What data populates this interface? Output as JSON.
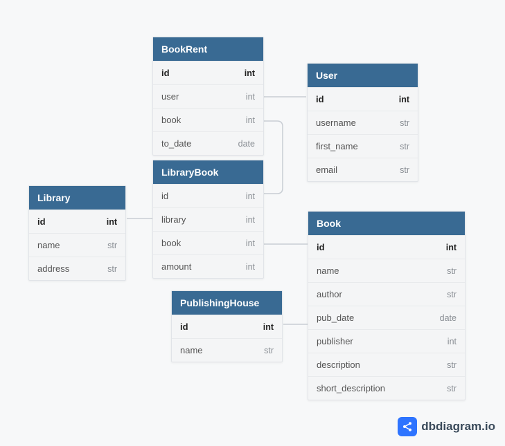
{
  "tables": {
    "bookrent": {
      "title": "BookRent",
      "rows": [
        {
          "name": "id",
          "type": "int",
          "pk": true
        },
        {
          "name": "user",
          "type": "int",
          "pk": false
        },
        {
          "name": "book",
          "type": "int",
          "pk": false
        },
        {
          "name": "to_date",
          "type": "date",
          "pk": false
        }
      ]
    },
    "user": {
      "title": "User",
      "rows": [
        {
          "name": "id",
          "type": "int",
          "pk": true
        },
        {
          "name": "username",
          "type": "str",
          "pk": false
        },
        {
          "name": "first_name",
          "type": "str",
          "pk": false
        },
        {
          "name": "email",
          "type": "str",
          "pk": false
        }
      ]
    },
    "librarybook": {
      "title": "LibraryBook",
      "rows": [
        {
          "name": "id",
          "type": "int",
          "pk": false
        },
        {
          "name": "library",
          "type": "int",
          "pk": false
        },
        {
          "name": "book",
          "type": "int",
          "pk": false
        },
        {
          "name": "amount",
          "type": "int",
          "pk": false
        }
      ]
    },
    "library": {
      "title": "Library",
      "rows": [
        {
          "name": "id",
          "type": "int",
          "pk": true
        },
        {
          "name": "name",
          "type": "str",
          "pk": false
        },
        {
          "name": "address",
          "type": "str",
          "pk": false
        }
      ]
    },
    "book": {
      "title": "Book",
      "rows": [
        {
          "name": "id",
          "type": "int",
          "pk": true
        },
        {
          "name": "name",
          "type": "str",
          "pk": false
        },
        {
          "name": "author",
          "type": "str",
          "pk": false
        },
        {
          "name": "pub_date",
          "type": "date",
          "pk": false
        },
        {
          "name": "publisher",
          "type": "int",
          "pk": false
        },
        {
          "name": "description",
          "type": "str",
          "pk": false
        },
        {
          "name": "short_description",
          "type": "str",
          "pk": false
        }
      ]
    },
    "publishinghouse": {
      "title": "PublishingHouse",
      "rows": [
        {
          "name": "id",
          "type": "int",
          "pk": true
        },
        {
          "name": "name",
          "type": "str",
          "pk": false
        }
      ]
    }
  },
  "watermark": {
    "text": "dbdiagram.io"
  },
  "relationships": [
    {
      "from": "bookrent.user",
      "to": "user.id"
    },
    {
      "from": "bookrent.book",
      "to": "librarybook.id"
    },
    {
      "from": "librarybook.library",
      "to": "library.id"
    },
    {
      "from": "librarybook.book",
      "to": "book.id"
    },
    {
      "from": "book.publisher",
      "to": "publishinghouse.id"
    }
  ]
}
